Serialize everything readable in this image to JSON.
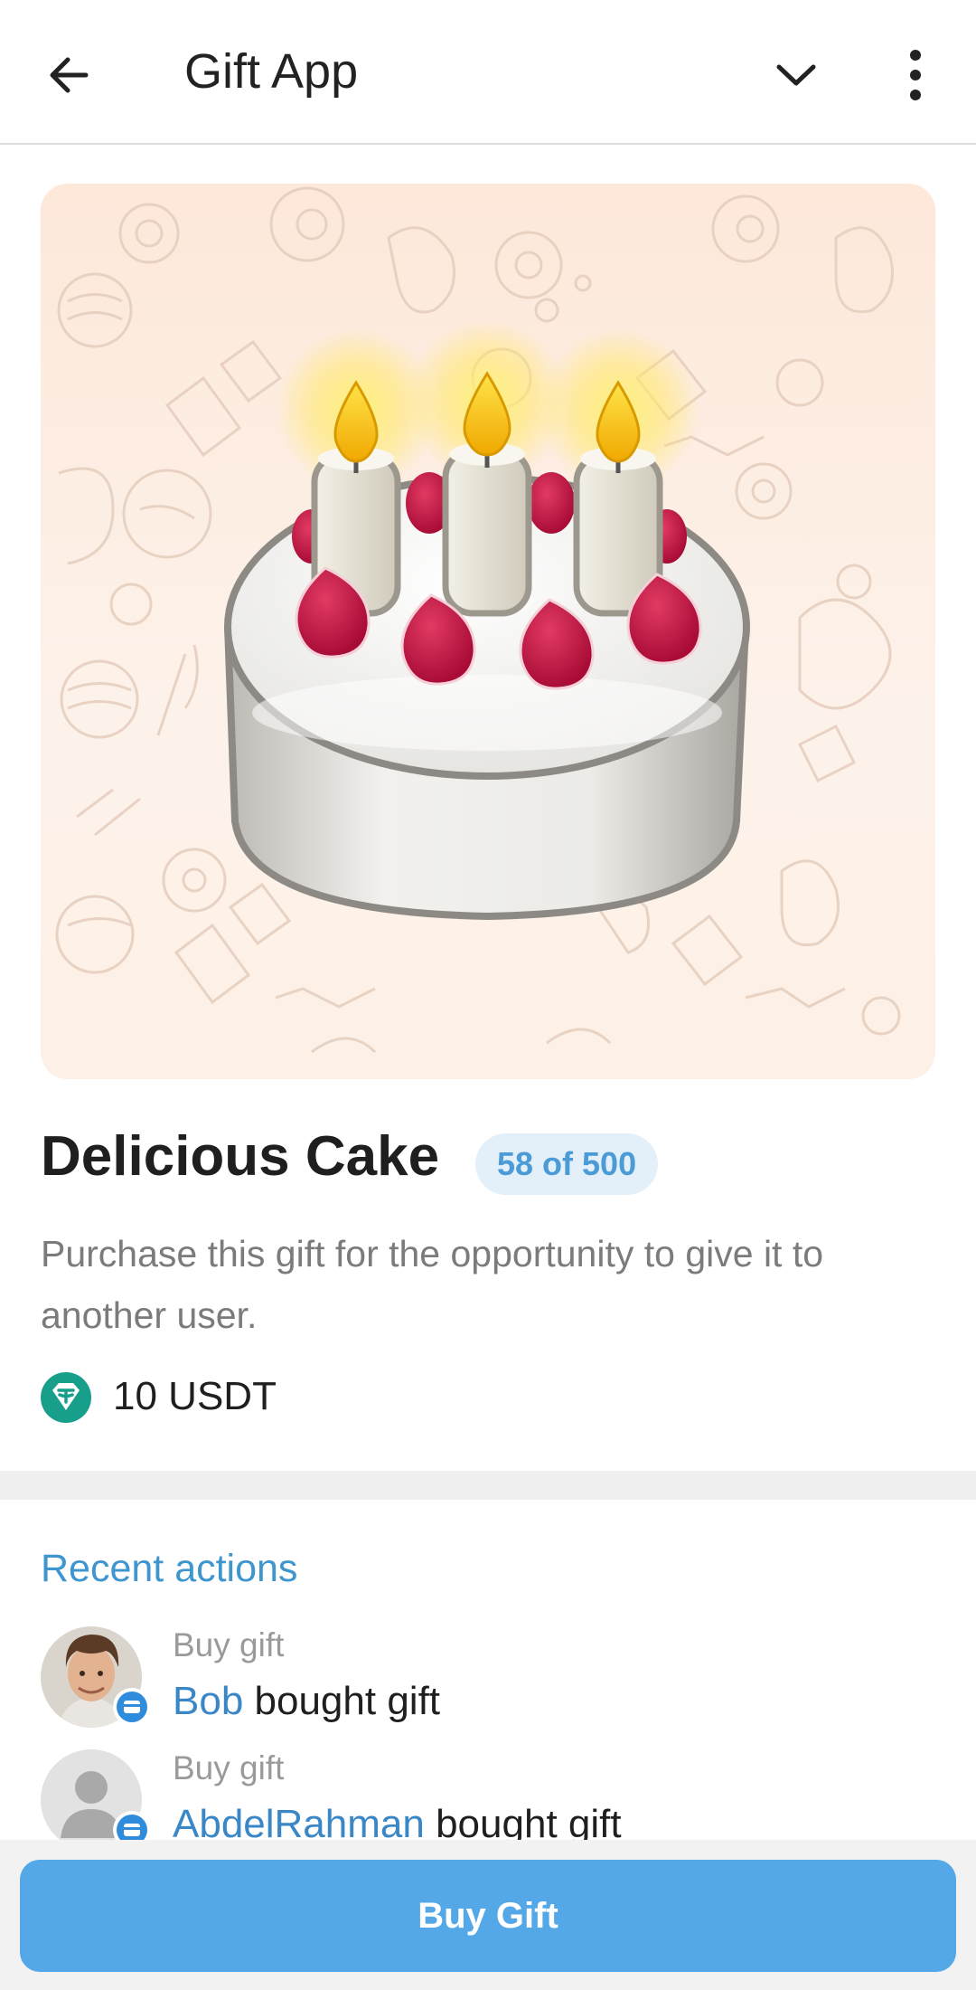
{
  "header": {
    "title": "Gift App",
    "back_icon": "arrow-left-icon",
    "expand_icon": "chevron-down-icon",
    "menu_icon": "more-vertical-icon"
  },
  "gift": {
    "image": "birthday-cake-with-candles",
    "name": "Delicious Cake",
    "availability": "58 of 500",
    "description": "Purchase this gift for the opportunity to give it to another user.",
    "price": "10 USDT",
    "currency_icon": "tether-usdt-icon"
  },
  "recent_actions": {
    "title": "Recent actions",
    "items": [
      {
        "type": "Buy gift",
        "user": "Bob",
        "text": " bought gift"
      },
      {
        "type": "Buy gift",
        "user": "AbdelRahman",
        "text": " bought gift"
      }
    ]
  },
  "footer": {
    "buy_label": "Buy Gift"
  },
  "colors": {
    "accent": "#54a8e8",
    "link": "#3a87c7",
    "badge_bg": "#e3eff9",
    "badge_text": "#4a9bd6",
    "usdt_green": "#179f8c",
    "hero_bg": "#fde8da"
  }
}
